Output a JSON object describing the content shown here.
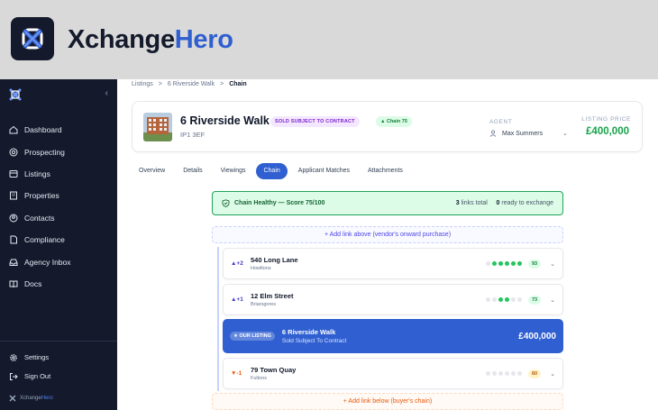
{
  "brand": {
    "name_part1": "Xchange",
    "name_part2": "Hero"
  },
  "sidebar": {
    "items": [
      {
        "label": "Dashboard",
        "icon": "home-icon"
      },
      {
        "label": "Prospecting",
        "icon": "target-icon"
      },
      {
        "label": "Listings",
        "icon": "list-icon"
      },
      {
        "label": "Properties",
        "icon": "building-icon"
      },
      {
        "label": "Contacts",
        "icon": "contact-icon"
      },
      {
        "label": "Compliance",
        "icon": "document-icon"
      },
      {
        "label": "Agency Inbox",
        "icon": "inbox-icon"
      },
      {
        "label": "Docs",
        "icon": "book-icon"
      }
    ],
    "bottom": [
      {
        "label": "Settings",
        "icon": "gear-icon"
      },
      {
        "label": "Sign Out",
        "icon": "sign-out-icon"
      }
    ],
    "footer_part1": "Xchange",
    "footer_part2": "Hero",
    "collapse_glyph": "‹"
  },
  "breadcrumb": {
    "root": "Listings",
    "parent": "6 Riverside Walk",
    "current": "Chain",
    "sep": ">"
  },
  "listing": {
    "title": "6 Riverside Walk",
    "postcode": "IP1 3EF",
    "status_badge": "SOLD SUBJECT TO CONTRACT",
    "chain_badge": "▲ Chain 75",
    "agent_label": "AGENT",
    "agent_name": "Max Summers",
    "price_label": "LISTING PRICE",
    "price": "£400,000"
  },
  "tabs": [
    {
      "label": "Overview",
      "active": false
    },
    {
      "label": "Details",
      "active": false
    },
    {
      "label": "Viewings",
      "active": false
    },
    {
      "label": "Chain",
      "active": true
    },
    {
      "label": "Applicant Matches",
      "active": false
    },
    {
      "label": "Attachments",
      "active": false
    }
  ],
  "health": {
    "text": "Chain Healthy — Score 75/100",
    "links_count": "3",
    "links_label": "links total",
    "ready_count": "0",
    "ready_label": "ready to exchange"
  },
  "add_above": "+ Add link above (vendor's onward purchase)",
  "add_below": "+ Add link below (buyer's chain)",
  "chain_links": [
    {
      "position": "▲+2",
      "direction": "up",
      "address": "540 Long Lane",
      "solicitor": "Howltons",
      "progress_steps": 6,
      "progress_done": 5,
      "score": "93",
      "score_tone": "green"
    },
    {
      "position": "▲+1",
      "direction": "up",
      "address": "12 Elm Street",
      "solicitor": "Briarsgores",
      "progress_steps": 6,
      "progress_done": 2,
      "progress_start": 2,
      "score": "73",
      "score_tone": "green"
    }
  ],
  "our_listing": {
    "badge": "★ OUR LISTING",
    "address": "6 Riverside Walk",
    "status": "Sold Subject To Contract",
    "price": "£400,000"
  },
  "buyer_link": {
    "position": "▼-1",
    "direction": "down",
    "address": "79 Town Quay",
    "solicitor": "Fultons",
    "progress_steps": 6,
    "progress_done": 0,
    "score": "60",
    "score_tone": "amber"
  },
  "colors": {
    "accent": "#2f5fd0",
    "sidebar": "#141a2c",
    "healthy": "#16a34a",
    "purple_badge": "#7e22ce"
  }
}
